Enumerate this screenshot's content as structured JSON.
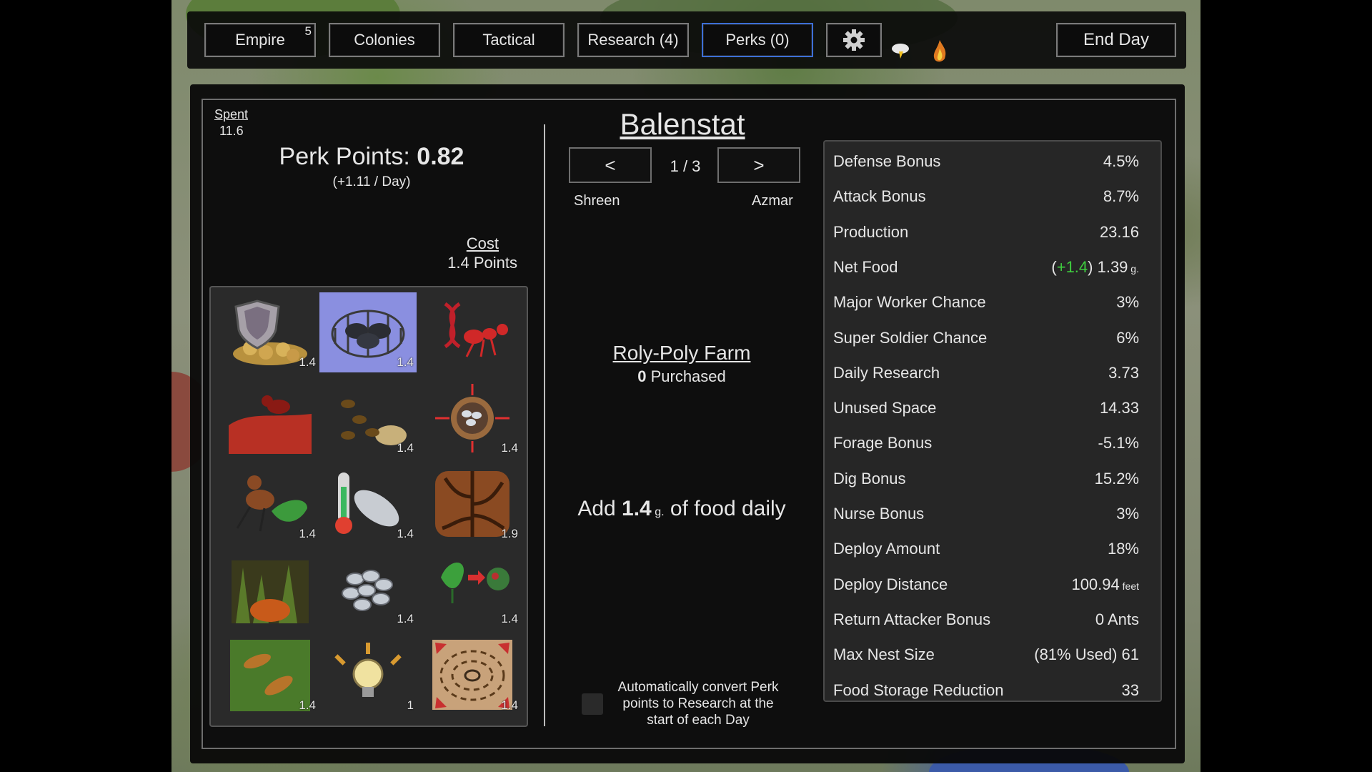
{
  "topbar": {
    "empire_label": "Empire",
    "empire_badge": "5",
    "colonies_label": "Colonies",
    "tactical_label": "Tactical",
    "research_label": "Research (4)",
    "perks_label": "Perks (0)",
    "settings_icon": "gear-icon",
    "end_day_label": "End Day"
  },
  "perks": {
    "spent_label": "Spent",
    "spent_value": "11.6",
    "points_label": "Perk Points: ",
    "points_value": "0.82",
    "rate": "(+1.11 / Day)",
    "cost_label": "Cost",
    "cost_value": "1.4 Points",
    "grid": [
      {
        "icon": "shield-on-eggs-icon",
        "cost": "1.4"
      },
      {
        "icon": "roly-poly-farm-icon",
        "cost": "1.4",
        "selected": true
      },
      {
        "icon": "red-ant-dna-icon",
        "cost": ""
      },
      {
        "icon": "red-ant-on-mound-icon",
        "cost": ""
      },
      {
        "icon": "ants-carrying-food-icon",
        "cost": "1.4"
      },
      {
        "icon": "expanding-eggs-icon",
        "cost": "1.4"
      },
      {
        "icon": "ant-with-leaf-icon",
        "cost": "1.4"
      },
      {
        "icon": "thermometer-egg-icon",
        "cost": "1.4"
      },
      {
        "icon": "tunnels-icon",
        "cost": "1.9"
      },
      {
        "icon": "grass-fire-icon",
        "cost": ""
      },
      {
        "icon": "egg-cluster-icon",
        "cost": "1.4"
      },
      {
        "icon": "leaf-to-fungus-icon",
        "cost": "1.4"
      },
      {
        "icon": "two-ants-icon",
        "cost": "1.4"
      },
      {
        "icon": "lightbulb-idea-icon",
        "cost": "1"
      },
      {
        "icon": "expanding-territory-icon",
        "cost": "1.4"
      }
    ]
  },
  "colony": {
    "name": "Balenstat",
    "prev_label": "<",
    "next_label": ">",
    "page": "1 / 3",
    "prev_name": "Shreen",
    "next_name": "Azmar"
  },
  "selected_perk": {
    "name": "Roly-Poly Farm",
    "purchased_count": "0",
    "purchased_label": " Purchased",
    "desc_prefix": "Add ",
    "desc_amount": "1.4",
    "desc_unit": " g.",
    "desc_suffix": " of food daily"
  },
  "auto_convert": {
    "label": "Automatically convert Perk points to Research at the start of each Day",
    "checked": false
  },
  "stats": [
    {
      "label": "Defense Bonus",
      "value": "4.5%"
    },
    {
      "label": "Attack Bonus",
      "value": "8.7%"
    },
    {
      "label": "Production",
      "value": "23.16"
    },
    {
      "label": "Net Food",
      "prefix": "(",
      "bonus": "+1.4",
      "suffix": ") 1.39",
      "unit": " g."
    },
    {
      "label": "Major Worker Chance",
      "value": "3%"
    },
    {
      "label": "Super Soldier Chance",
      "value": "6%"
    },
    {
      "label": "Daily Research",
      "value": "3.73"
    },
    {
      "label": "Unused Space",
      "value": "14.33"
    },
    {
      "label": "Forage Bonus",
      "value": "-5.1%"
    },
    {
      "label": "Dig Bonus",
      "value": "15.2%"
    },
    {
      "label": "Nurse Bonus",
      "value": "3%"
    },
    {
      "label": "Deploy Amount",
      "value": "18%"
    },
    {
      "label": "Deploy Distance",
      "value": "100.94",
      "unit": " feet"
    },
    {
      "label": "Return Attacker Bonus",
      "value": "0 Ants"
    },
    {
      "label": "Max Nest Size",
      "value": "(81% Used)  61"
    },
    {
      "label": "Food Storage Reduction",
      "value": "33"
    }
  ],
  "colors": {
    "accent": "#3d6fd6",
    "selected_cell": "#8a8fe0",
    "bonus_green": "#3fcf3f"
  }
}
